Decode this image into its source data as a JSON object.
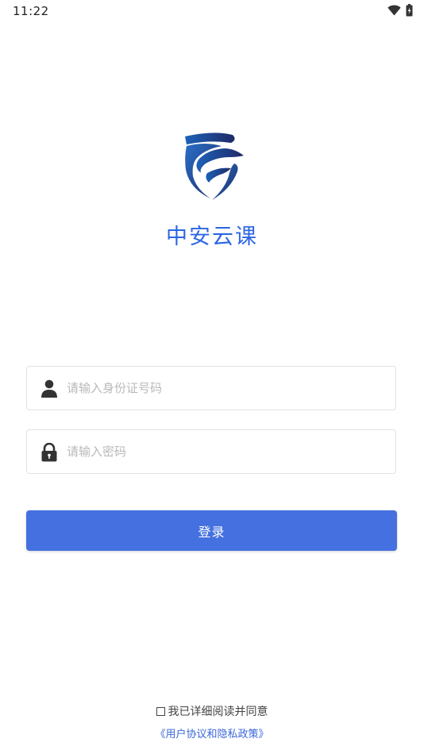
{
  "status_bar": {
    "time": "11:22"
  },
  "brand": {
    "app_name": "中安云课",
    "logo_icon": "shield-logo-icon",
    "accent_color": "#2d66e3"
  },
  "form": {
    "id_field": {
      "placeholder": "请输入身份证号码",
      "value": "",
      "icon": "user-icon"
    },
    "password_field": {
      "placeholder": "请输入密码",
      "value": "",
      "icon": "lock-icon"
    },
    "login_label": "登录",
    "login_color": "#4571e0"
  },
  "agreement": {
    "text": "我已详细阅读并同意",
    "link": "《用户协议和隐私政策》"
  }
}
